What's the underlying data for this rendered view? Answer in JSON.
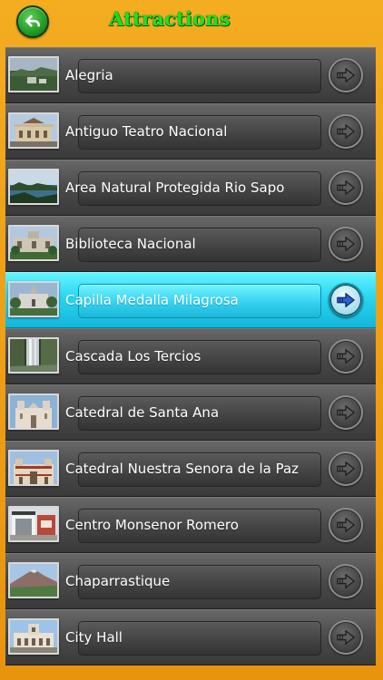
{
  "header": {
    "title": "Attractions",
    "back_icon": "back-arrow-icon"
  },
  "colors": {
    "background": "#efa319",
    "title": "#16e51e",
    "row": "#4b4b4b",
    "row_selected": "#2bd4f0",
    "text": "#ffffff"
  },
  "list": {
    "items": [
      {
        "label": "Alegria",
        "selected": false
      },
      {
        "label": "Antiguo Teatro Nacional",
        "selected": false
      },
      {
        "label": "Area Natural Protegida Rio Sapo",
        "selected": false
      },
      {
        "label": "Biblioteca Nacional",
        "selected": false
      },
      {
        "label": "Capilla Medalla Milagrosa",
        "selected": true
      },
      {
        "label": "Cascada Los Tercios",
        "selected": false
      },
      {
        "label": "Catedral de Santa Ana",
        "selected": false
      },
      {
        "label": "Catedral Nuestra Senora de la Paz",
        "selected": false
      },
      {
        "label": "Centro Monsenor Romero",
        "selected": false
      },
      {
        "label": "Chaparrastique",
        "selected": false
      },
      {
        "label": "City Hall",
        "selected": false
      }
    ]
  }
}
